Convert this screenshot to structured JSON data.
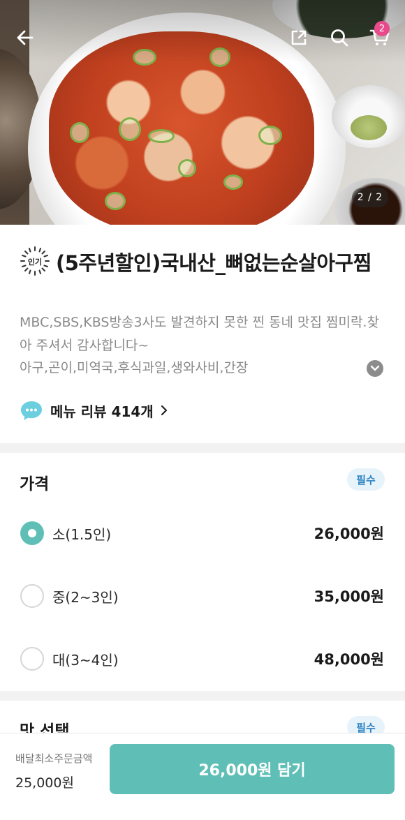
{
  "header": {
    "back_icon": "arrow-left-icon",
    "share_icon": "share-icon",
    "search_icon": "search-icon",
    "cart_icon": "cart-icon",
    "cart_count": "2",
    "image_indicator": "2 / 2"
  },
  "product": {
    "badge_text": "인기",
    "title": "(5주년할인)국내산_뼈없는순살아구찜",
    "description": "MBC,SBS,KBS방송3사도 발견하지 못한 찐 동네 맛집 찜미락.찾아 주셔서 감사합니다~",
    "ingredients": "아구,곤이,미역국,후식과일,생와사비,간장",
    "review_link": "메뉴 리뷰 414개"
  },
  "price_section": {
    "title": "가격",
    "required": "필수",
    "options": [
      {
        "label": "소(1.5인)",
        "price": "26,000원",
        "selected": true
      },
      {
        "label": "중(2~3인)",
        "price": "35,000원",
        "selected": false
      },
      {
        "label": "대(3~4인)",
        "price": "48,000원",
        "selected": false
      }
    ]
  },
  "taste_section": {
    "title": "맛 선택",
    "required": "필수"
  },
  "bottom_bar": {
    "min_order_label": "배달최소주문금액",
    "min_order_value": "25,000원",
    "add_button": "26,000원 담기"
  },
  "colors": {
    "accent": "#5fbfb6",
    "badge_pink": "#e84a8c",
    "required_blue": "#2d83c3"
  }
}
